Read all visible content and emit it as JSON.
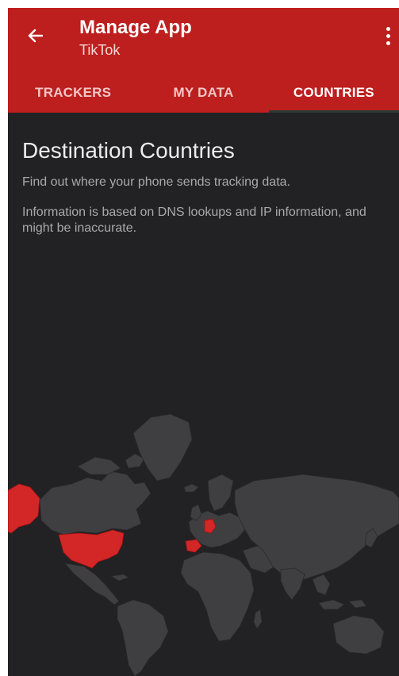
{
  "header": {
    "title": "Manage App",
    "subtitle": "TikTok",
    "back_icon": "arrow-left-icon",
    "menu_icon": "more-vertical-icon",
    "color": "#bd1e1e"
  },
  "tabs": [
    {
      "label": "TRACKERS",
      "active": false
    },
    {
      "label": "MY DATA",
      "active": false
    },
    {
      "label": "COUNTRIES",
      "active": true
    }
  ],
  "main": {
    "heading": "Destination Countries",
    "description": "Find out where your phone sends tracking data.",
    "disclaimer": "Information is based on DNS lookups and IP information, and might be inaccurate."
  },
  "map": {
    "highlight_color": "#d32627",
    "land_color": "#3f3f42",
    "highlighted_countries": [
      "United States",
      "Germany",
      "Spain"
    ]
  }
}
